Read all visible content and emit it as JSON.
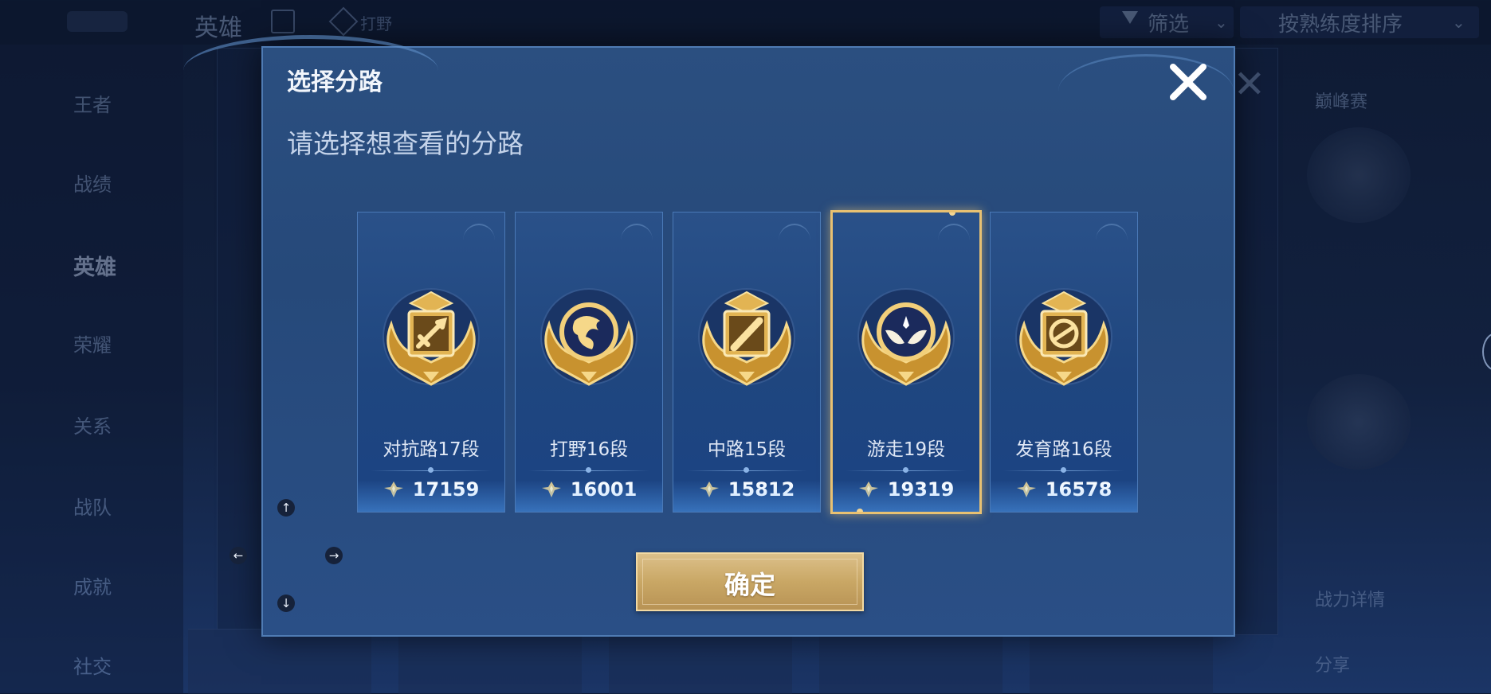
{
  "background": {
    "title": "英雄",
    "diamond_text": "打野",
    "filter_label": "筛选",
    "sort_label": "按熟练度排序",
    "sidebar_items": [
      "王者",
      "战绩",
      "英雄",
      "荣耀",
      "关系",
      "战队",
      "成就",
      "社交"
    ],
    "right_texts": [
      "巅峰赛",
      "战力详情",
      "分享"
    ]
  },
  "modal": {
    "title": "选择分路",
    "subtitle": "请选择想查看的分路",
    "close_icon": "close-x-icon",
    "confirm_label": "确定"
  },
  "lanes": [
    {
      "label": "对抗路17段",
      "score": "17159",
      "emblem": "sword-emblem-icon",
      "selected": false
    },
    {
      "label": "打野16段",
      "score": "16001",
      "emblem": "dragon-emblem-icon",
      "selected": false
    },
    {
      "label": "中路15段",
      "score": "15812",
      "emblem": "staff-emblem-icon",
      "selected": false
    },
    {
      "label": "游走19段",
      "score": "19319",
      "emblem": "wings-emblem-icon",
      "selected": true
    },
    {
      "label": "发育路16段",
      "score": "16578",
      "emblem": "coin-emblem-icon",
      "selected": false
    }
  ],
  "arrows": {
    "up": "↑",
    "left": "←",
    "right": "→",
    "down": "↓"
  },
  "colors": {
    "gold": "#e8c172",
    "panel": "#26497a",
    "confirm": "#c9a765"
  }
}
